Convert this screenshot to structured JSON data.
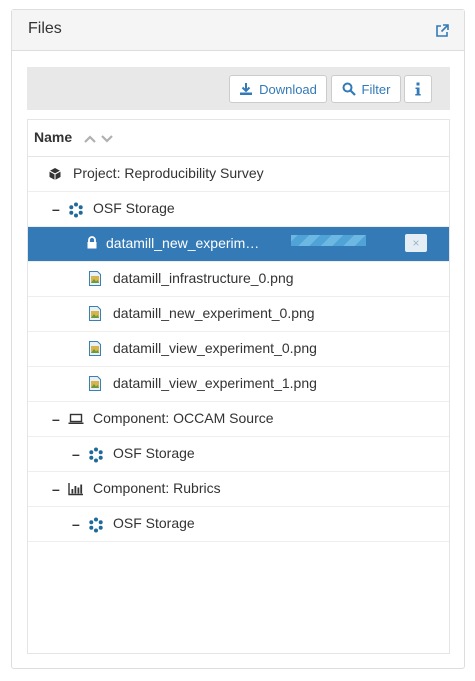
{
  "panel": {
    "title": "Files",
    "external_link_icon": "external-link-icon"
  },
  "toolbar": {
    "download_label": "Download",
    "filter_label": "Filter",
    "info_icon": "info-icon"
  },
  "grid": {
    "header": "Name",
    "rows": [
      {
        "toggle": "",
        "icon": "cube-icon",
        "label": "Project: Reproducibility Survey",
        "selected": false
      },
      {
        "toggle": "–",
        "icon": "storage-icon",
        "label": "OSF Storage",
        "selected": false
      },
      {
        "toggle": "",
        "icon": "lock-icon",
        "label": "datamill_new_experim…",
        "selected": true,
        "upload_progress": 1.0,
        "cancel_label": "×"
      },
      {
        "toggle": "",
        "icon": "image-file-icon",
        "label": "datamill_infrastructure_0.png",
        "selected": false
      },
      {
        "toggle": "",
        "icon": "image-file-icon",
        "label": "datamill_new_experiment_0.png",
        "selected": false
      },
      {
        "toggle": "",
        "icon": "image-file-icon",
        "label": "datamill_view_experiment_0.png",
        "selected": false
      },
      {
        "toggle": "",
        "icon": "image-file-icon",
        "label": "datamill_view_experiment_1.png",
        "selected": false
      },
      {
        "toggle": "–",
        "icon": "laptop-icon",
        "label": "Component: OCCAM Source",
        "selected": false
      },
      {
        "toggle": "–",
        "icon": "storage-icon",
        "label": "OSF Storage",
        "selected": false
      },
      {
        "toggle": "–",
        "icon": "bar-chart-icon",
        "label": "Component: Rubrics",
        "selected": false
      },
      {
        "toggle": "–",
        "icon": "storage-icon",
        "label": "OSF Storage",
        "selected": false
      }
    ]
  }
}
